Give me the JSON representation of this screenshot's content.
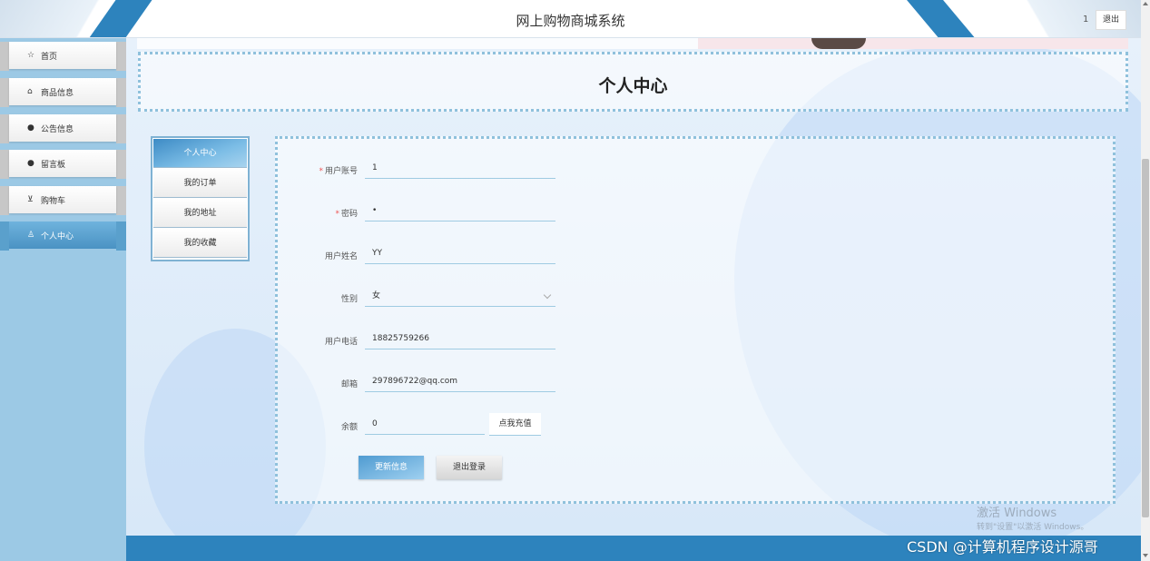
{
  "header": {
    "title": "网上购物商城系统",
    "username": "1",
    "logout_label": "退出"
  },
  "sidebar": {
    "items": [
      {
        "label": "首页",
        "icon": "star-icon",
        "glyph": "☆",
        "active": false
      },
      {
        "label": "商品信息",
        "icon": "bag-icon",
        "glyph": "⌂",
        "active": false
      },
      {
        "label": "公告信息",
        "icon": "info-icon",
        "glyph": "●",
        "active": false
      },
      {
        "label": "留言板",
        "icon": "question-icon",
        "glyph": "●",
        "active": false
      },
      {
        "label": "购物车",
        "icon": "cart-icon",
        "glyph": "⊻",
        "active": false
      },
      {
        "label": "个人中心",
        "icon": "user-icon",
        "glyph": "♙",
        "active": true
      }
    ]
  },
  "page": {
    "title": "个人中心"
  },
  "tabs": [
    {
      "label": "个人中心",
      "active": true
    },
    {
      "label": "我的订单",
      "active": false
    },
    {
      "label": "我的地址",
      "active": false
    },
    {
      "label": "我的收藏",
      "active": false
    }
  ],
  "form": {
    "fields": [
      {
        "label": "用户账号",
        "required": true,
        "value": "1"
      },
      {
        "label": "密码",
        "required": true,
        "value": "•"
      },
      {
        "label": "用户姓名",
        "required": false,
        "value": "YY"
      },
      {
        "label": "性别",
        "required": false,
        "value": "女"
      },
      {
        "label": "用户电话",
        "required": false,
        "value": "18825759266"
      },
      {
        "label": "邮箱",
        "required": false,
        "value": "297896722@qq.com"
      },
      {
        "label": "余额",
        "required": false,
        "value": "0"
      }
    ],
    "recharge_label": "点我充值",
    "update_label": "更新信息",
    "logout_label": "退出登录"
  },
  "overlay": {
    "activate_title": "激活 Windows",
    "activate_sub": "转到\"设置\"以激活 Windows。",
    "watermark": "CSDN @计算机程序设计源哥"
  },
  "colors": {
    "accent": "#2d83bd",
    "sidebar": "#9cc9e5",
    "required": "#ee5555"
  }
}
